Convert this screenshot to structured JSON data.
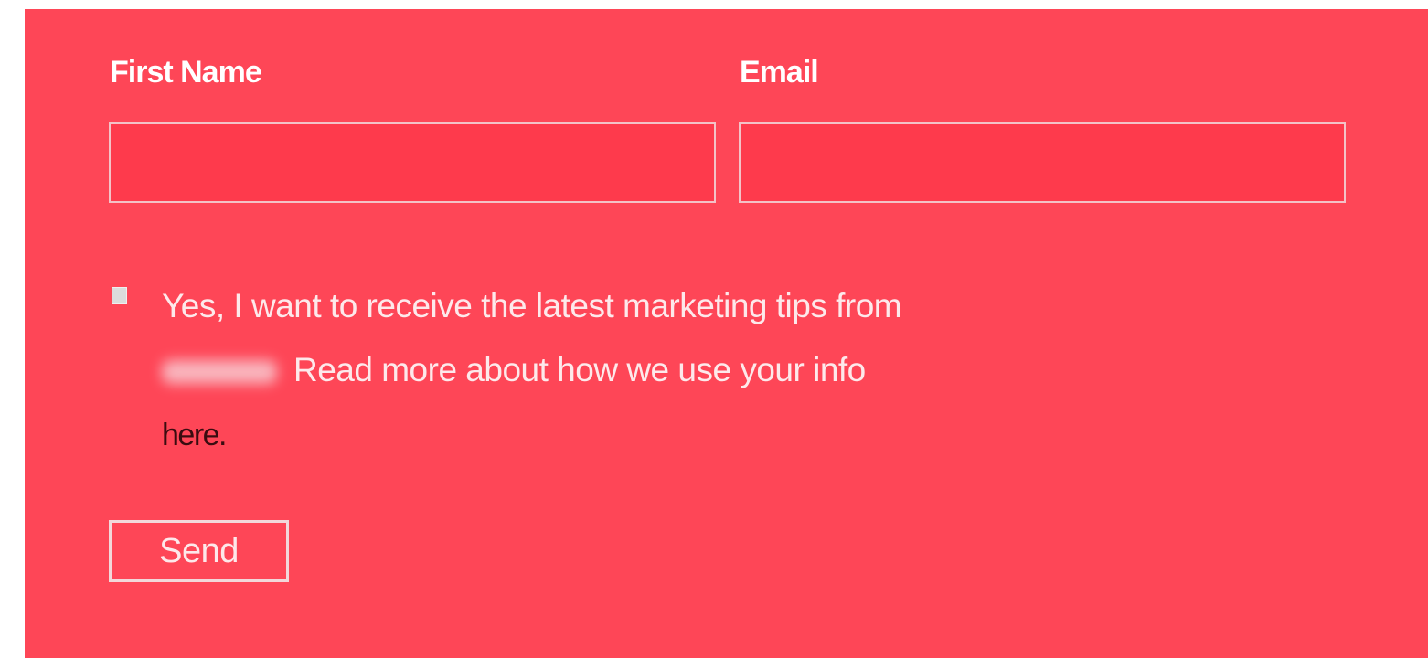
{
  "form": {
    "first_name_label": "First Name",
    "email_label": "Email",
    "first_name_value": "",
    "email_value": "",
    "consent": {
      "checked": false,
      "line1": "Yes, I want to receive the latest marketing tips from",
      "line2": "Read more about how we use your info",
      "link_text": "here."
    },
    "send_label": "Send"
  },
  "colors": {
    "panel_background": "#fe4657",
    "input_background": "#fe3a4c",
    "link_text": "#3a0c10"
  }
}
